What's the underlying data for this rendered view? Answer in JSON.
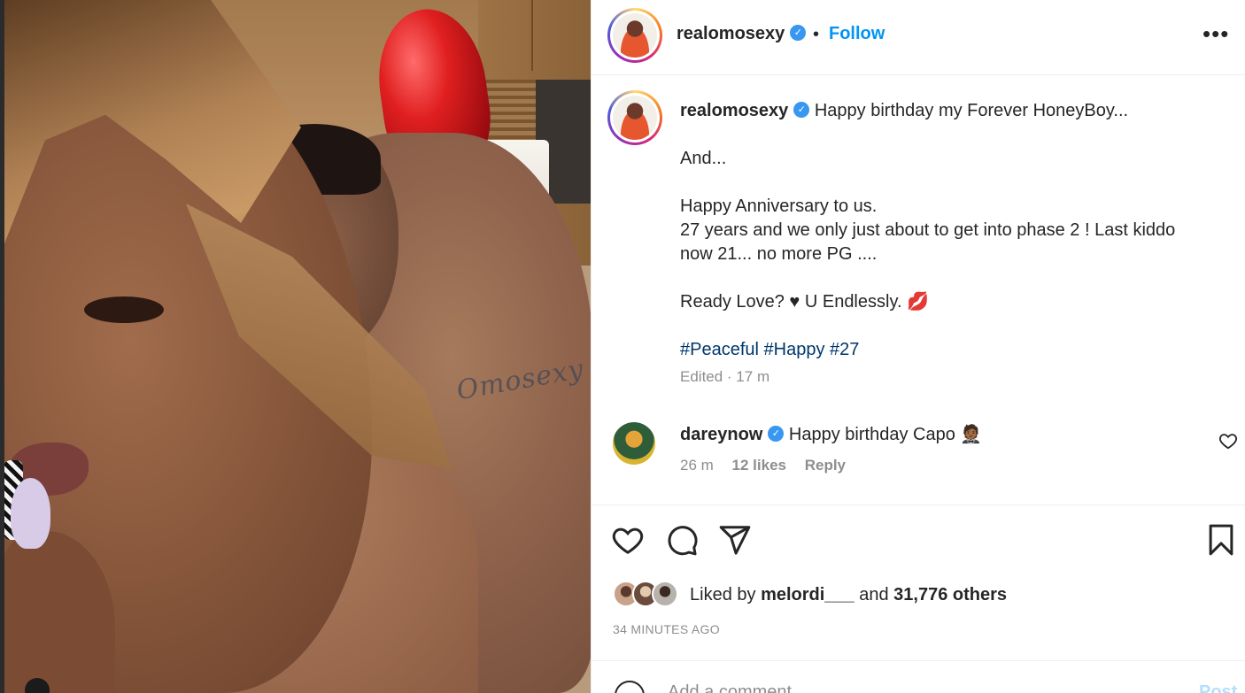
{
  "post": {
    "username": "realomosexy",
    "verified_mark": "✓",
    "separator": "•",
    "follow_label": "Follow",
    "more_label": "•••",
    "tattoo_text": "Omosexy"
  },
  "caption": {
    "username": "realomosexy",
    "lines": [
      "Happy birthday my Forever HoneyBoy...",
      "",
      "And...",
      "",
      "Happy Anniversary to us.",
      "27 years and we only just about to get into phase 2 ! Last kiddo",
      "now 21... no more PG ....",
      "",
      "Ready Love? ♥ U Endlessly. 💋",
      ""
    ],
    "hashtags": "#Peaceful #Happy #27",
    "meta": "Edited · 17 m"
  },
  "comment": {
    "username": "dareynow",
    "text": "Happy birthday Capo 🤵🏾",
    "time": "26 m",
    "likes": "12 likes",
    "reply_label": "Reply"
  },
  "actions": {
    "icons": [
      "heart-icon",
      "comment-icon",
      "share-icon",
      "bookmark-icon"
    ],
    "liked_by_prefix": "Liked by",
    "liked_by_user": "melordi___",
    "liked_by_and": "and",
    "liked_by_others": "31,776 others",
    "timestamp": "34 MINUTES AGO"
  },
  "add_comment": {
    "placeholder": "Add a comment...",
    "post_label": "Post"
  },
  "colors": {
    "accent": "#0095f6",
    "hashtag": "#00376b",
    "muted": "#8e8e8e",
    "verified": "#3897f0"
  }
}
